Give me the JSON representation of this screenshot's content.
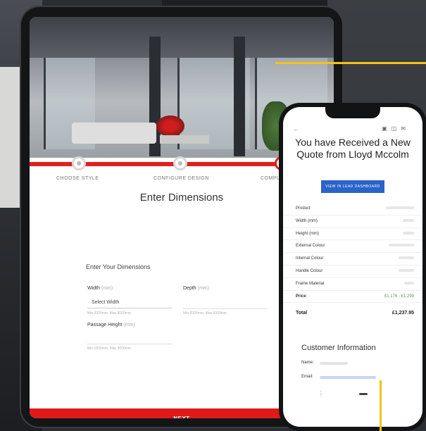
{
  "tablet": {
    "steps": [
      {
        "label": "CHOOSE STYLE"
      },
      {
        "label": "CONFIGURE DESIGN"
      },
      {
        "label": "COMPLE"
      }
    ],
    "progress_percent": 84,
    "heading": "Enter Dimensions",
    "form": {
      "title": "Enter Your Dimensions",
      "width_label": "Width",
      "width_unit": "(mm)",
      "width_value": "Select Width",
      "width_hint": "Min 2000mm, Max 8000mm",
      "depth_label": "Depth",
      "depth_unit": "(mm)",
      "depth_hint": "Min 2000mm, Max 6000mm",
      "passage_label": "Passage Height",
      "passage_unit": "(mm)",
      "passage_hint": "Min 1800mm, Max 3000mm"
    },
    "next_label": "NEXT"
  },
  "phone": {
    "title": "You have Received a New Quote from Lloyd Mccolm",
    "dashboard_button": "VIEW IN LEAD DASHBOARD",
    "rows": [
      {
        "label": "Product"
      },
      {
        "label": "Width (mm)"
      },
      {
        "label": "Height (mm)"
      },
      {
        "label": "External Colour"
      },
      {
        "label": "Internal Colour"
      },
      {
        "label": "Handle Colour"
      },
      {
        "label": "Frame Material"
      }
    ],
    "price_label": "Price",
    "price_value": "£1,176 - £1,299",
    "total_label": "Total",
    "total_value": "£1,237.95",
    "customer_title": "Customer Information",
    "name_label": "Name:",
    "email_label": "Email:"
  },
  "colors": {
    "accent_red": "#e01a1a",
    "link_blue": "#2a63c9",
    "callout_yellow": "#f2c21c",
    "price_green": "#59a04a"
  }
}
